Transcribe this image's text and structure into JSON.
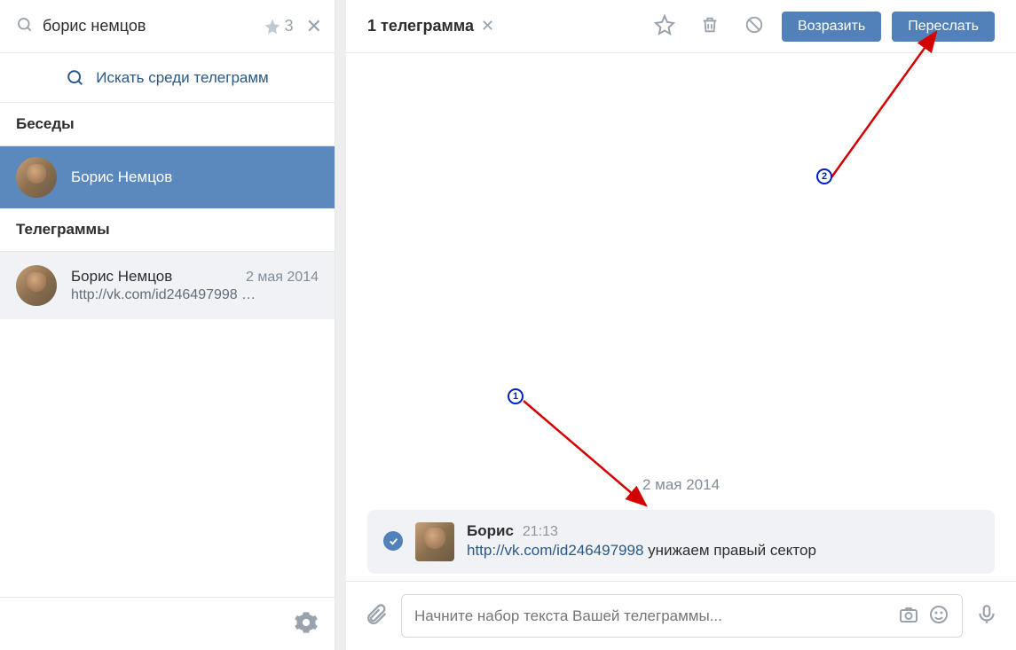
{
  "sidebar": {
    "search_value": "борис немцов",
    "favorites_count": "3",
    "search_telegrams_label": "Искать среди телеграмм",
    "sections": {
      "conversations_header": "Беседы",
      "telegrams_header": "Телеграммы"
    },
    "contacts": [
      {
        "name": "Борис Немцов"
      }
    ],
    "telegrams": [
      {
        "name": "Борис Немцов",
        "date": "2 мая 2014",
        "preview": "http://vk.com/id246497998 …"
      }
    ]
  },
  "header": {
    "selection_label": "1 телеграмма",
    "reply_button": "Возразить",
    "forward_button": "Переслать"
  },
  "conversation": {
    "date_divider": "2 мая 2014",
    "message": {
      "author": "Борис",
      "time": "21:13",
      "link": "http://vk.com/id246497998",
      "text": "унижаем правый сектор"
    }
  },
  "compose": {
    "placeholder": "Начните набор текста Вашей телеграммы..."
  },
  "annotations": {
    "marker1": "1",
    "marker2": "2"
  }
}
